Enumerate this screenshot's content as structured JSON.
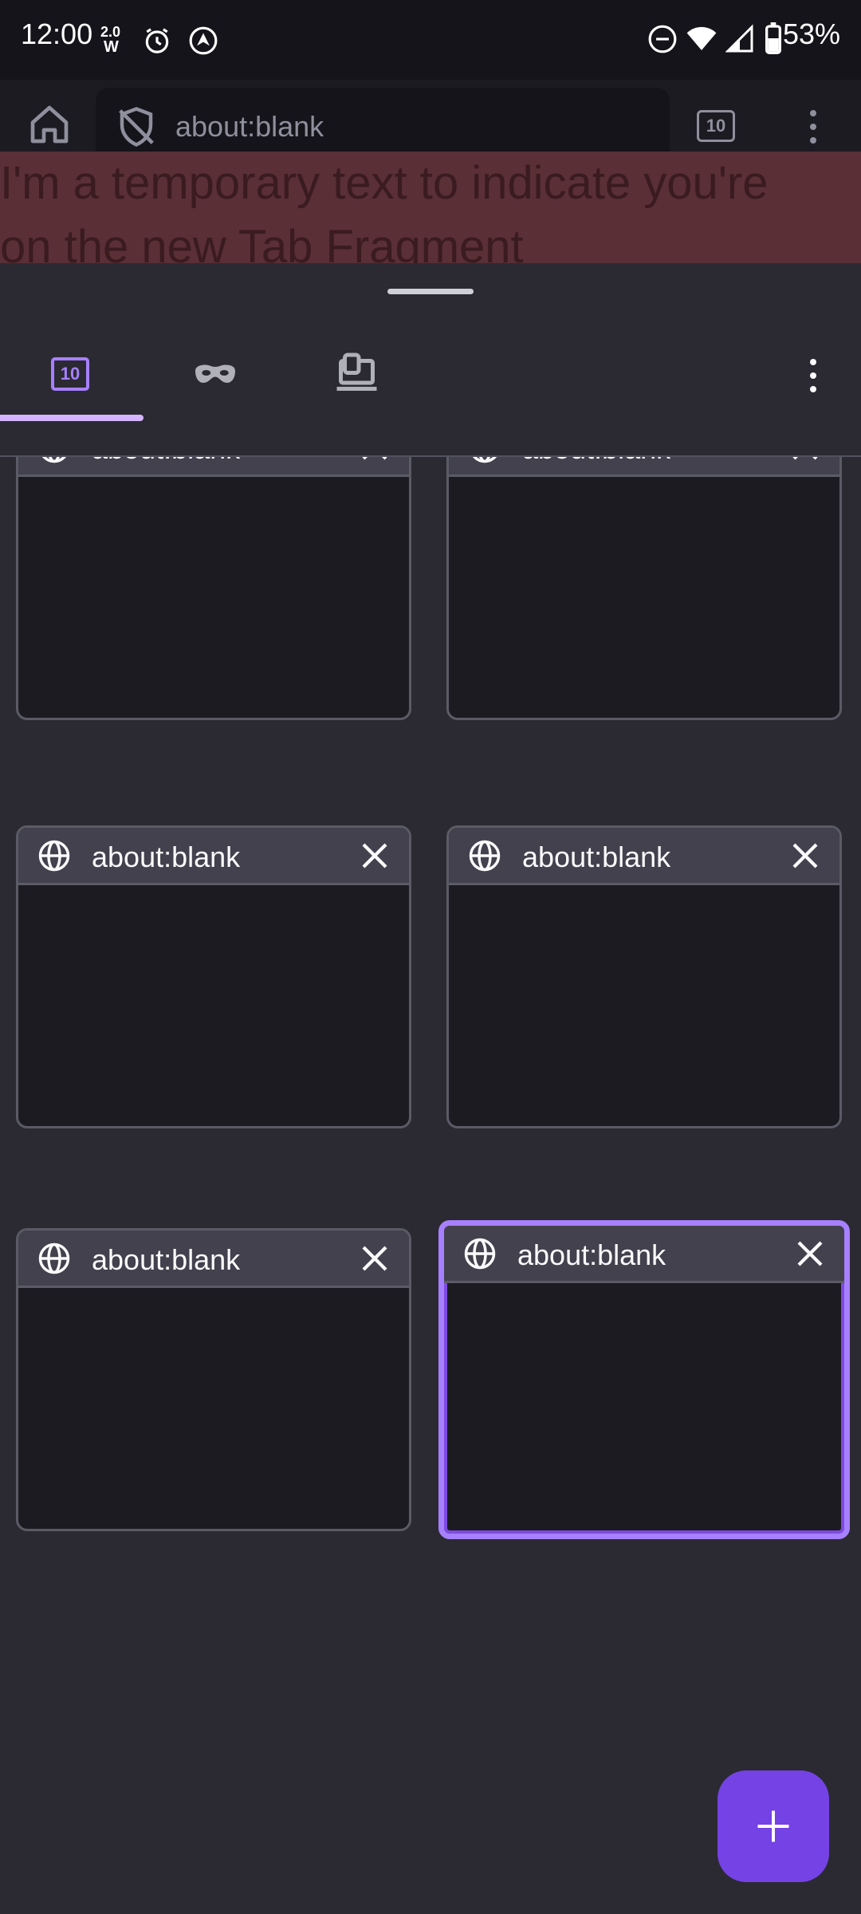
{
  "status_bar": {
    "time": "12:00",
    "speed": "2.0",
    "speed_unit": "W",
    "battery": "53%"
  },
  "toolbar": {
    "url": "about:blank",
    "tab_count": "10"
  },
  "temporary_text": {
    "line1": "I'm a temporary text to indicate you're",
    "line2": "on the new Tab Fragment"
  },
  "tab_tray": {
    "normal_tab_count": "10"
  },
  "tabs": [
    {
      "title": "about:blank"
    },
    {
      "title": "about:blank"
    },
    {
      "title": "about:blank"
    },
    {
      "title": "about:blank"
    },
    {
      "title": "about:blank"
    },
    {
      "title": "about:blank"
    }
  ],
  "colors": {
    "accent": "#7542e5",
    "selected_border": "#a780ff",
    "underline": "#d5b4ff"
  }
}
